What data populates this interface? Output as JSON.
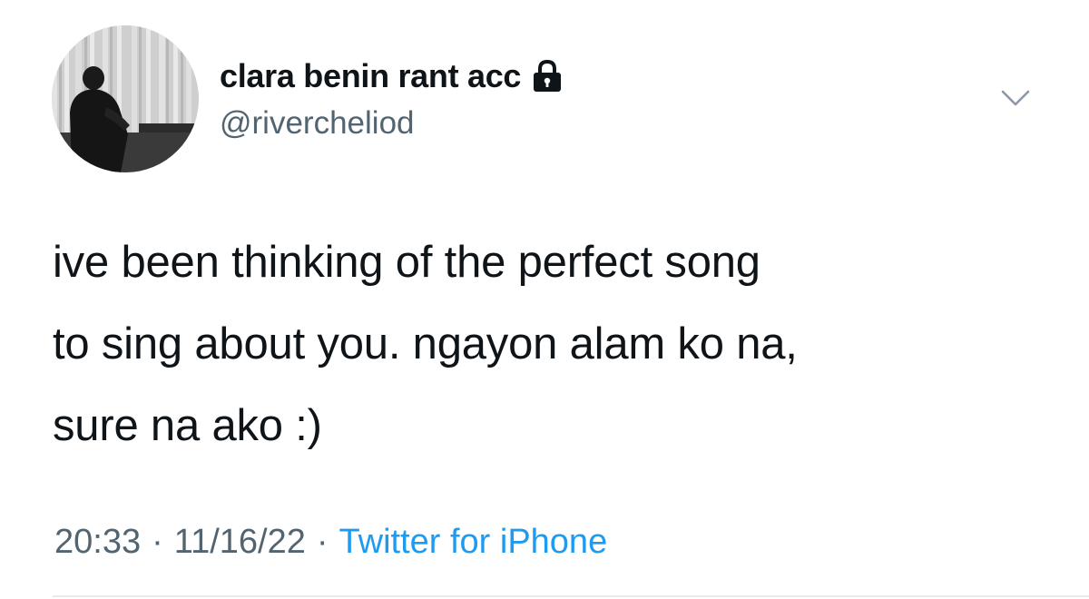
{
  "tweet": {
    "author": {
      "display_name": "clara benin rant acc",
      "handle": "@rivercheliod",
      "protected_icon": "lock-icon",
      "avatar_icon": "person-photo"
    },
    "menu_icon": "chevron-down-icon",
    "text_lines": [
      "ive been thinking of the perfect song",
      "to sing about you. ngayon alam ko na,",
      "sure na ako :)"
    ],
    "meta": {
      "time": "20:33",
      "separator": "·",
      "date": "11/16/22",
      "source": "Twitter for iPhone"
    }
  },
  "colors": {
    "text_primary": "#0f1419",
    "text_secondary": "#536471",
    "link": "#1d9bf0",
    "divider": "#e7e9ea"
  }
}
